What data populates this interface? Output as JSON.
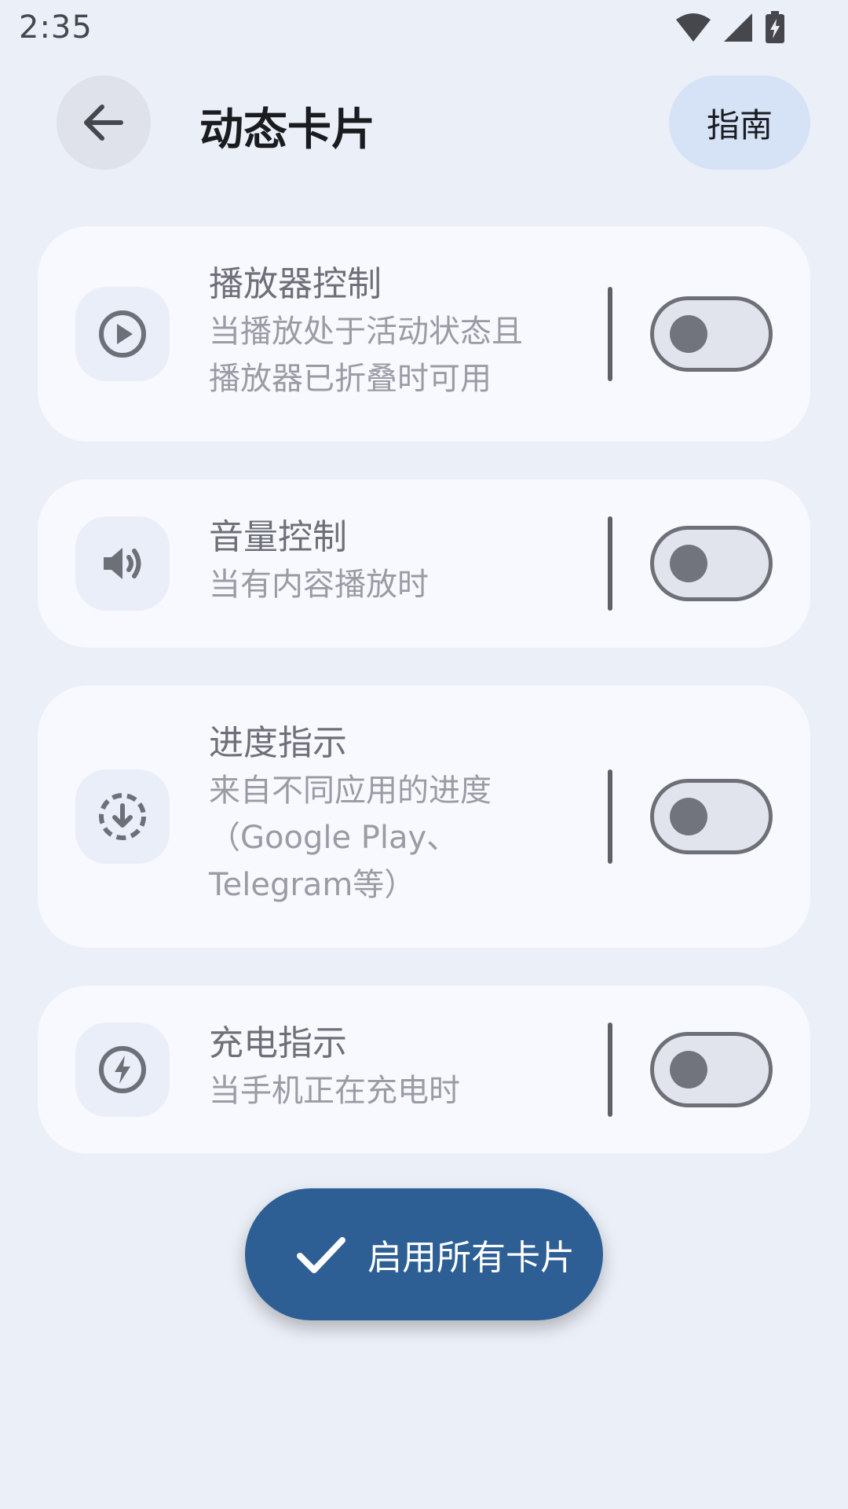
{
  "status_bar": {
    "time": "2:35",
    "icons": [
      "wifi-icon",
      "signal-icon",
      "battery-charging-icon"
    ]
  },
  "header": {
    "title": "动态卡片",
    "guide_label": "指南",
    "back_icon": "arrow-left-icon"
  },
  "cards": [
    {
      "title": "播放器控制",
      "desc_lines": [
        "当播放处于活动状态且",
        "播放器已折叠时可用"
      ],
      "icon": "play-circle-icon",
      "enabled": false
    },
    {
      "title": "音量控制",
      "desc_lines": [
        "当有内容播放时"
      ],
      "icon": "volume-icon",
      "enabled": false
    },
    {
      "title": "进度指示",
      "desc_lines": [
        "来自不同应用的进度",
        "（Google Play、",
        "Telegram等）"
      ],
      "icon": "download-progress-icon",
      "enabled": false
    },
    {
      "title": "充电指示",
      "desc_lines": [
        "当手机正在充电时"
      ],
      "icon": "charging-bolt-icon",
      "enabled": false
    }
  ],
  "fab": {
    "label": "启用所有卡片",
    "icon": "check-icon"
  },
  "colors": {
    "background": "#EBEFF7",
    "card": "#F7F9FF",
    "accent": "#2D5F95",
    "guide_button": "#D6E3F7"
  }
}
